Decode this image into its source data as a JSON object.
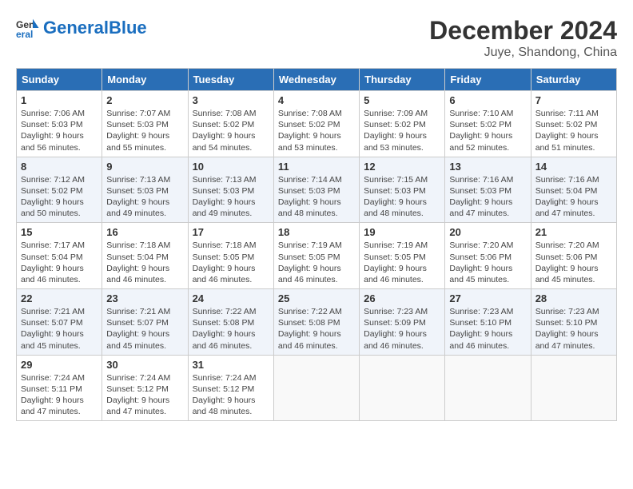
{
  "logo": {
    "text_general": "General",
    "text_blue": "Blue"
  },
  "header": {
    "month": "December 2024",
    "location": "Juye, Shandong, China"
  },
  "days_of_week": [
    "Sunday",
    "Monday",
    "Tuesday",
    "Wednesday",
    "Thursday",
    "Friday",
    "Saturday"
  ],
  "weeks": [
    [
      {
        "day": "1",
        "info": "Sunrise: 7:06 AM\nSunset: 5:03 PM\nDaylight: 9 hours\nand 56 minutes."
      },
      {
        "day": "2",
        "info": "Sunrise: 7:07 AM\nSunset: 5:03 PM\nDaylight: 9 hours\nand 55 minutes."
      },
      {
        "day": "3",
        "info": "Sunrise: 7:08 AM\nSunset: 5:02 PM\nDaylight: 9 hours\nand 54 minutes."
      },
      {
        "day": "4",
        "info": "Sunrise: 7:08 AM\nSunset: 5:02 PM\nDaylight: 9 hours\nand 53 minutes."
      },
      {
        "day": "5",
        "info": "Sunrise: 7:09 AM\nSunset: 5:02 PM\nDaylight: 9 hours\nand 53 minutes."
      },
      {
        "day": "6",
        "info": "Sunrise: 7:10 AM\nSunset: 5:02 PM\nDaylight: 9 hours\nand 52 minutes."
      },
      {
        "day": "7",
        "info": "Sunrise: 7:11 AM\nSunset: 5:02 PM\nDaylight: 9 hours\nand 51 minutes."
      }
    ],
    [
      {
        "day": "8",
        "info": "Sunrise: 7:12 AM\nSunset: 5:02 PM\nDaylight: 9 hours\nand 50 minutes."
      },
      {
        "day": "9",
        "info": "Sunrise: 7:13 AM\nSunset: 5:03 PM\nDaylight: 9 hours\nand 49 minutes."
      },
      {
        "day": "10",
        "info": "Sunrise: 7:13 AM\nSunset: 5:03 PM\nDaylight: 9 hours\nand 49 minutes."
      },
      {
        "day": "11",
        "info": "Sunrise: 7:14 AM\nSunset: 5:03 PM\nDaylight: 9 hours\nand 48 minutes."
      },
      {
        "day": "12",
        "info": "Sunrise: 7:15 AM\nSunset: 5:03 PM\nDaylight: 9 hours\nand 48 minutes."
      },
      {
        "day": "13",
        "info": "Sunrise: 7:16 AM\nSunset: 5:03 PM\nDaylight: 9 hours\nand 47 minutes."
      },
      {
        "day": "14",
        "info": "Sunrise: 7:16 AM\nSunset: 5:04 PM\nDaylight: 9 hours\nand 47 minutes."
      }
    ],
    [
      {
        "day": "15",
        "info": "Sunrise: 7:17 AM\nSunset: 5:04 PM\nDaylight: 9 hours\nand 46 minutes."
      },
      {
        "day": "16",
        "info": "Sunrise: 7:18 AM\nSunset: 5:04 PM\nDaylight: 9 hours\nand 46 minutes."
      },
      {
        "day": "17",
        "info": "Sunrise: 7:18 AM\nSunset: 5:05 PM\nDaylight: 9 hours\nand 46 minutes."
      },
      {
        "day": "18",
        "info": "Sunrise: 7:19 AM\nSunset: 5:05 PM\nDaylight: 9 hours\nand 46 minutes."
      },
      {
        "day": "19",
        "info": "Sunrise: 7:19 AM\nSunset: 5:05 PM\nDaylight: 9 hours\nand 46 minutes."
      },
      {
        "day": "20",
        "info": "Sunrise: 7:20 AM\nSunset: 5:06 PM\nDaylight: 9 hours\nand 45 minutes."
      },
      {
        "day": "21",
        "info": "Sunrise: 7:20 AM\nSunset: 5:06 PM\nDaylight: 9 hours\nand 45 minutes."
      }
    ],
    [
      {
        "day": "22",
        "info": "Sunrise: 7:21 AM\nSunset: 5:07 PM\nDaylight: 9 hours\nand 45 minutes."
      },
      {
        "day": "23",
        "info": "Sunrise: 7:21 AM\nSunset: 5:07 PM\nDaylight: 9 hours\nand 45 minutes."
      },
      {
        "day": "24",
        "info": "Sunrise: 7:22 AM\nSunset: 5:08 PM\nDaylight: 9 hours\nand 46 minutes."
      },
      {
        "day": "25",
        "info": "Sunrise: 7:22 AM\nSunset: 5:08 PM\nDaylight: 9 hours\nand 46 minutes."
      },
      {
        "day": "26",
        "info": "Sunrise: 7:23 AM\nSunset: 5:09 PM\nDaylight: 9 hours\nand 46 minutes."
      },
      {
        "day": "27",
        "info": "Sunrise: 7:23 AM\nSunset: 5:10 PM\nDaylight: 9 hours\nand 46 minutes."
      },
      {
        "day": "28",
        "info": "Sunrise: 7:23 AM\nSunset: 5:10 PM\nDaylight: 9 hours\nand 47 minutes."
      }
    ],
    [
      {
        "day": "29",
        "info": "Sunrise: 7:24 AM\nSunset: 5:11 PM\nDaylight: 9 hours\nand 47 minutes."
      },
      {
        "day": "30",
        "info": "Sunrise: 7:24 AM\nSunset: 5:12 PM\nDaylight: 9 hours\nand 47 minutes."
      },
      {
        "day": "31",
        "info": "Sunrise: 7:24 AM\nSunset: 5:12 PM\nDaylight: 9 hours\nand 48 minutes."
      },
      {
        "day": "",
        "info": ""
      },
      {
        "day": "",
        "info": ""
      },
      {
        "day": "",
        "info": ""
      },
      {
        "day": "",
        "info": ""
      }
    ]
  ]
}
